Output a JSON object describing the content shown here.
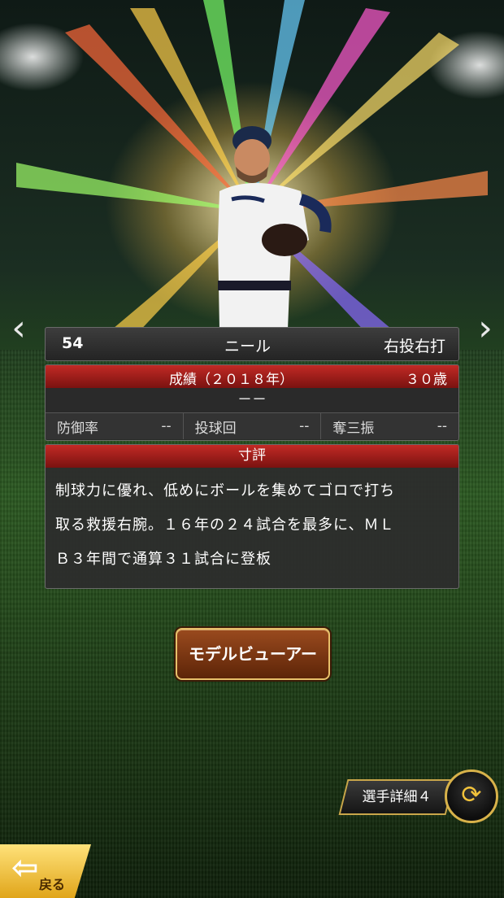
{
  "player": {
    "number": "54",
    "name": "ニール",
    "throws_bats": "右投右打"
  },
  "record": {
    "year_label": "成績（２０１８年）",
    "age": "３０歳",
    "summary": "－－",
    "stats": [
      {
        "label": "防御率",
        "value": "--"
      },
      {
        "label": "投球回",
        "value": "--"
      },
      {
        "label": "奪三振",
        "value": "--"
      }
    ]
  },
  "comment": {
    "header": "寸評",
    "lines": [
      "制球力に優れ、低めにボールを集めてゴロで打ち",
      "取る救援右腕。１６年の２４試合を最多に、ＭＬ",
      "Ｂ３年間で通算３１試合に登板"
    ]
  },
  "buttons": {
    "model_viewer": "モデルビューアー",
    "player_detail": "選手詳細４",
    "back": "戻る"
  },
  "icons": {
    "prev": "chevron-left-icon",
    "next": "chevron-right-icon",
    "swap": "swap-arrows-icon",
    "back": "back-arrow-icon"
  },
  "colors": {
    "header_red": "#b3221e",
    "button_brown": "#7a3512",
    "gold": "#d8b24a"
  }
}
